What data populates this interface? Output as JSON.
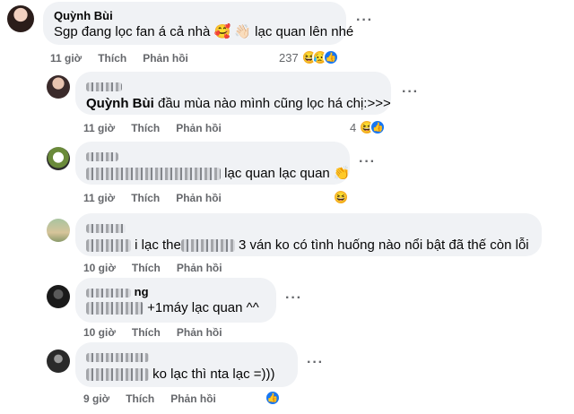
{
  "comments": [
    {
      "author": "Quỳnh Bùi",
      "text": "Sgp đang lọc fan á cả nhà 🥰 👋🏻  lạc quan lên nhé",
      "time": "11 giờ",
      "like_label": "Thích",
      "reply_label": "Phản hồi",
      "reaction_count": "237"
    },
    {
      "mention": "Quỳnh Bùi",
      "text": " đầu mùa nào mình cũng lọc há chị:>>>",
      "time": "11 giờ",
      "like_label": "Thích",
      "reply_label": "Phản hồi",
      "reaction_count": "4"
    },
    {
      "text": "lạc quan lạc quan 👏",
      "time": "11 giờ",
      "like_label": "Thích",
      "reply_label": "Phản hồi"
    },
    {
      "text_a": "i lạc the",
      "text_b": "3 ván ko có tình huống nào nổi bật đã thế còn lỗi",
      "time": "10 giờ",
      "like_label": "Thích",
      "reply_label": "Phản hồi"
    },
    {
      "author_partial": "ng",
      "text": "+1máy lạc quan ^^",
      "time": "10 giờ",
      "like_label": "Thích",
      "reply_label": "Phản hồi"
    },
    {
      "text": "ko lạc thì nta lạc =)))",
      "time": "9 giờ",
      "like_label": "Thích",
      "reply_label": "Phản hồi"
    }
  ],
  "more_label": "···",
  "icons": {
    "like": "like-icon",
    "haha": "haha-icon",
    "love": "care-icon"
  },
  "colors": {
    "bubble": "#f0f2f5",
    "meta": "#65676b",
    "like": "#1877f2"
  }
}
